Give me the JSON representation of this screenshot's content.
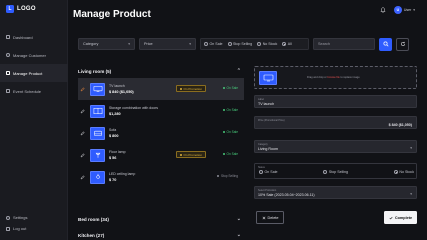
{
  "app": {
    "logo_text": "LOGO",
    "logo_mark": "L"
  },
  "sidebar": {
    "items": [
      {
        "label": "Dashboard",
        "icon": "grid-icon"
      },
      {
        "label": "Manage Customer",
        "icon": "users-icon"
      },
      {
        "label": "Manage Product",
        "icon": "box-icon"
      },
      {
        "label": "Event Schedule",
        "icon": "calendar-icon"
      }
    ],
    "bottom": [
      {
        "label": "Settings",
        "icon": "gear-icon"
      },
      {
        "label": "Log out",
        "icon": "logout-icon"
      }
    ]
  },
  "header": {
    "title": "Manage Product",
    "user_initial": "U",
    "user_name": "User"
  },
  "filters": {
    "category": "Category",
    "price": "Price",
    "radios": [
      "On Sale",
      "Stop Selling",
      "No Stock",
      "All"
    ],
    "selected_radio": "All",
    "search_placeholder": "Search"
  },
  "groups": {
    "living": "Living room (5)",
    "bed": "Bed room (34)",
    "kitchen": "Kitchen (27)"
  },
  "products": [
    {
      "name": "TV launch",
      "price": "$ 840 ($1,050)",
      "promo": "On Promotion",
      "status": "On Sale",
      "status_kind": "on",
      "selected": true
    },
    {
      "name": "Storage combination with doors",
      "price": "$1,280",
      "promo": "",
      "status": "On Sale",
      "status_kind": "on",
      "selected": false
    },
    {
      "name": "Sofa",
      "price": "$ 800",
      "promo": "",
      "status": "On Sale",
      "status_kind": "on",
      "selected": false
    },
    {
      "name": "Floor lamp",
      "price": "$ 56",
      "promo": "On Promotion",
      "status": "On Sale",
      "status_kind": "on",
      "selected": false
    },
    {
      "name": "LED ceiling lamp",
      "price": "$ 70",
      "promo": "",
      "status": "Stop Selling",
      "status_kind": "stop",
      "selected": false
    }
  ],
  "detail": {
    "upload_text_pre": "Drag and drop or ",
    "upload_link": "browse file",
    "upload_text_post": " to replace image",
    "label_field_label": "Label",
    "label_value": "TV launch",
    "price_label": "Price (Promotional Price)",
    "price_value": "$ 840 ($1,050)",
    "category_label": "Category",
    "category_value": "Living Room",
    "status_label": "Status",
    "status_options": [
      "On Sale",
      "Stop Selling",
      "No Stock"
    ],
    "status_selected": "No Stock",
    "promo_label": "Select Promotion",
    "promo_value": "10% Sale (2023.05.04~2023.06.11)",
    "delete_label": "Delete",
    "complete_label": "Complete"
  },
  "colors": {
    "accent": "#2f5cff",
    "on_sale": "#47c97a",
    "promo": "#e0b43b",
    "link": "#e25252"
  }
}
